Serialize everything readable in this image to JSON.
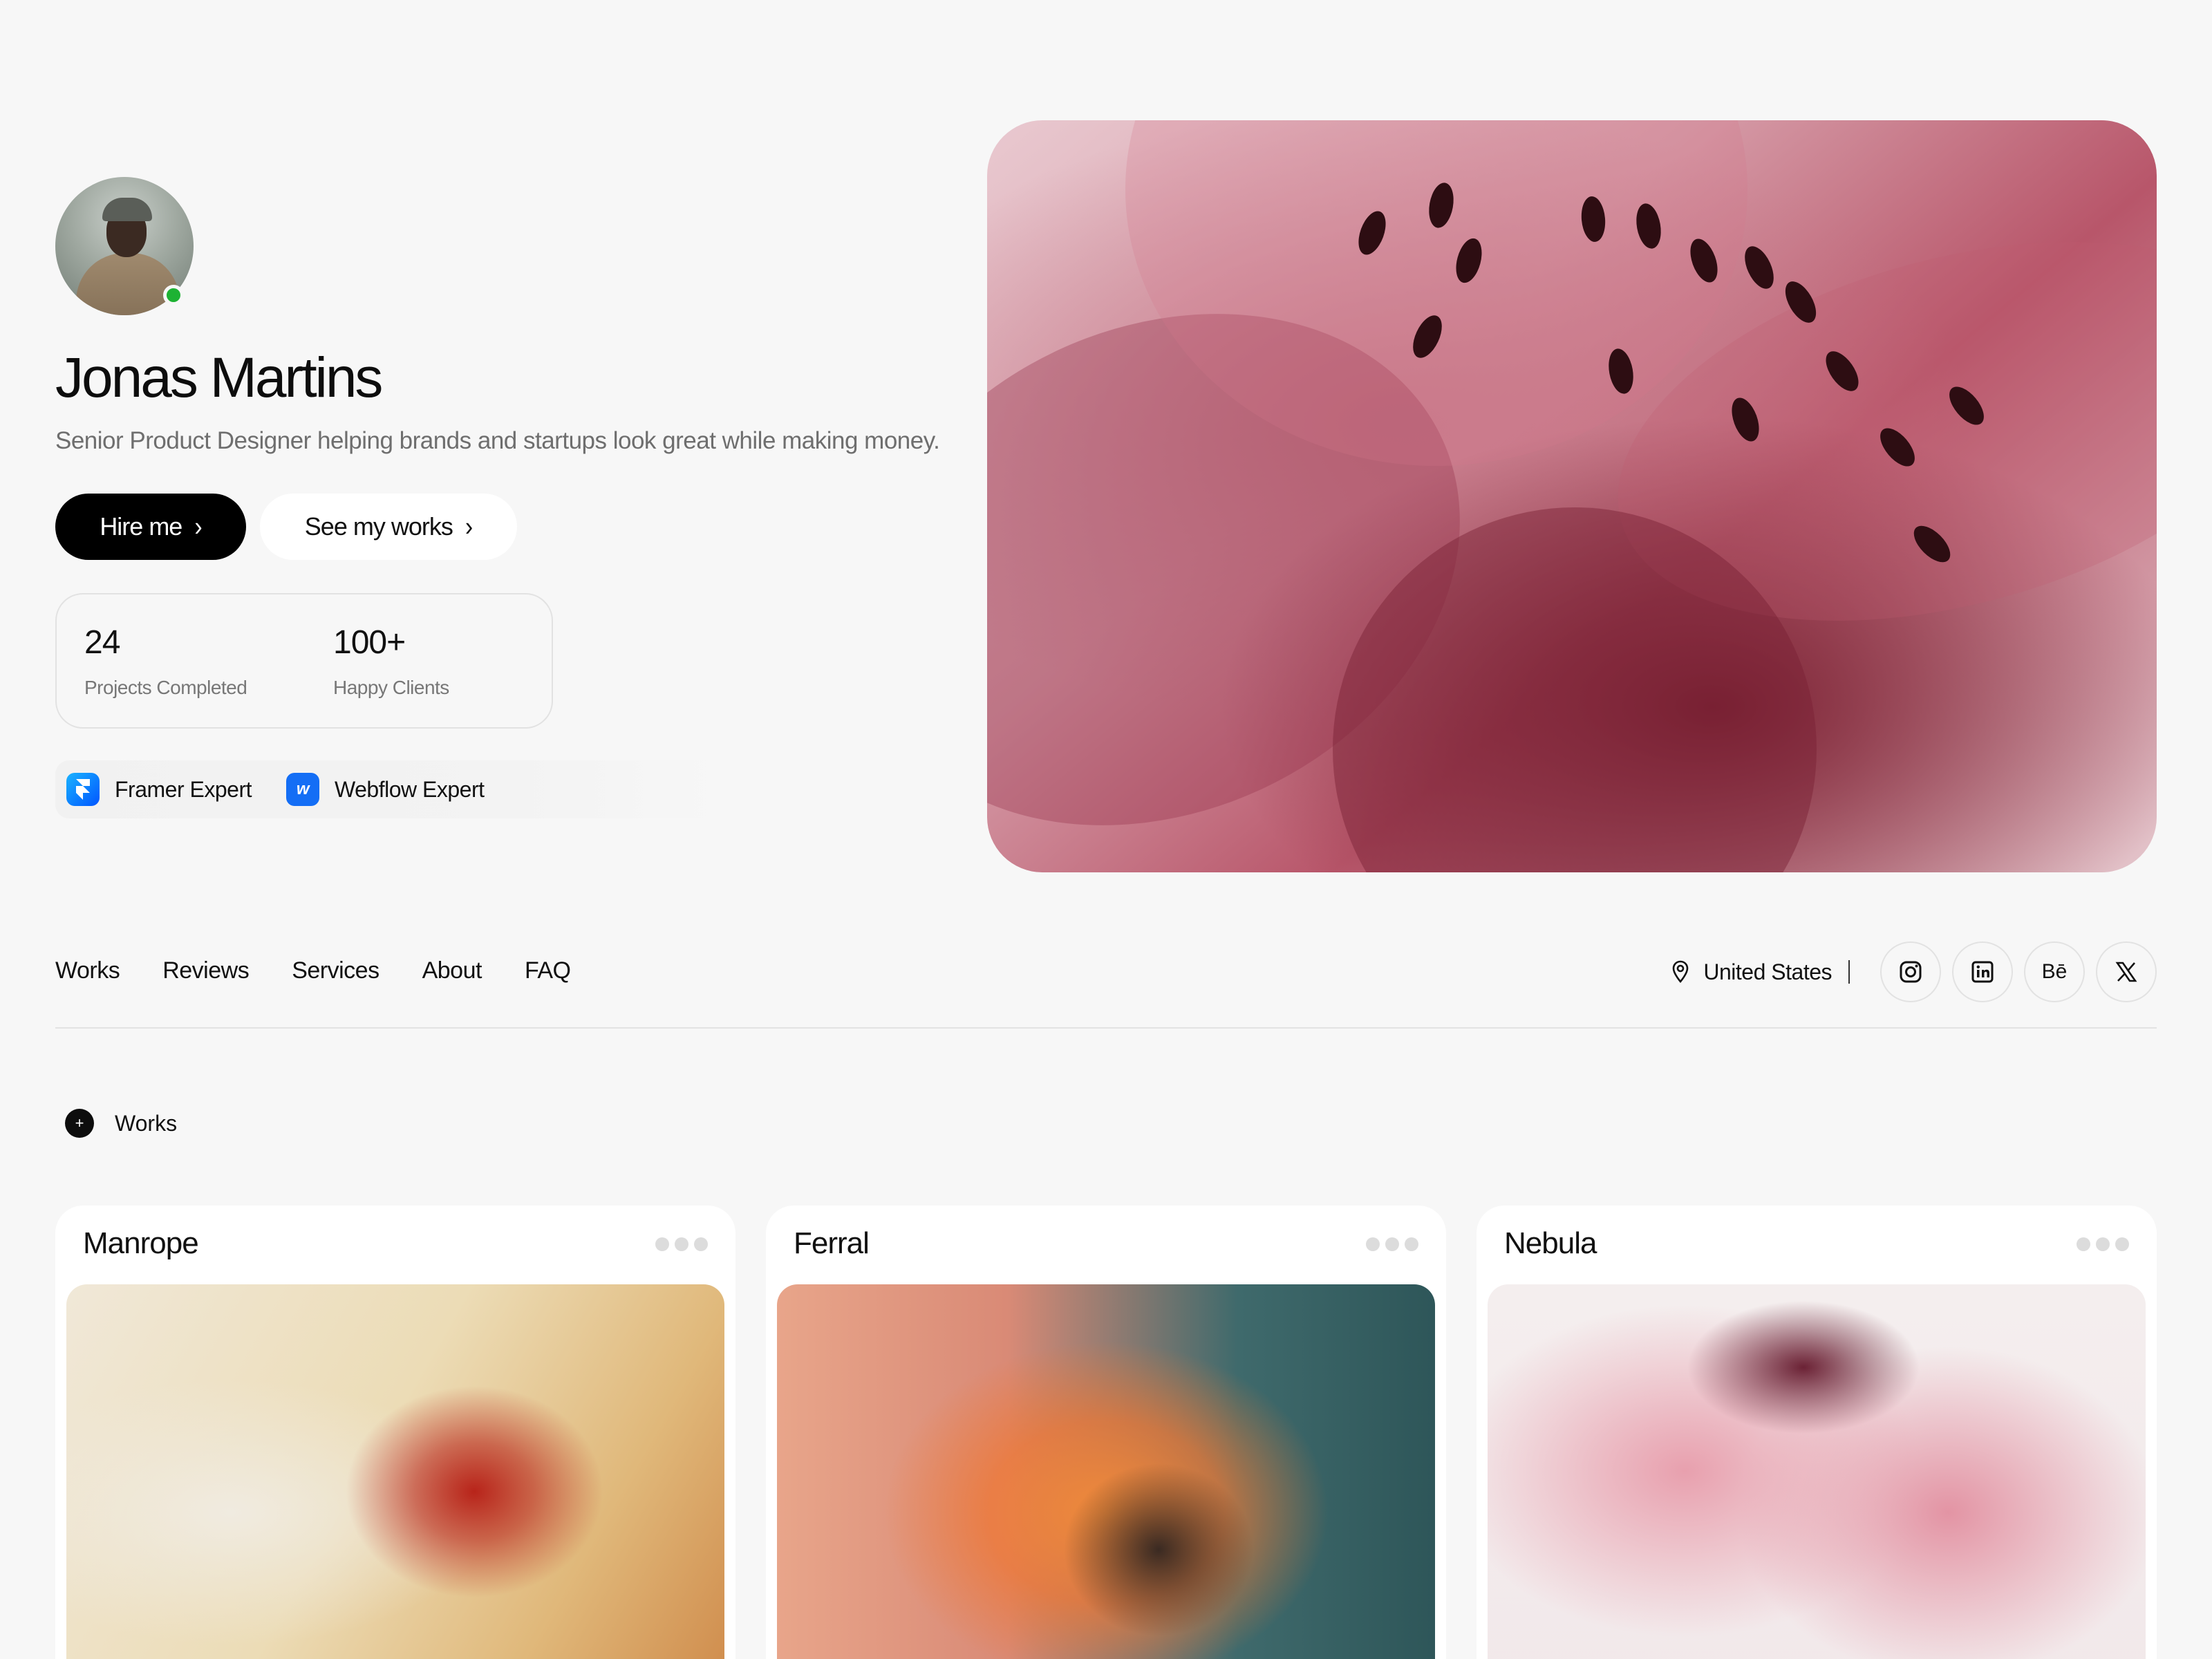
{
  "profile": {
    "name": "Jonas Martins",
    "bio": "Senior Product Designer helping brands and startups look great while making money."
  },
  "actions": {
    "hire_label": "Hire me",
    "works_label": "See my works"
  },
  "stats": [
    {
      "value": "24",
      "label": "Projects Completed"
    },
    {
      "value": "100+",
      "label": "Happy Clients"
    }
  ],
  "badges": [
    {
      "label": "Framer Expert",
      "icon": "framer-icon"
    },
    {
      "label": "Webflow Expert",
      "icon": "webflow-icon"
    }
  ],
  "nav": {
    "items": [
      "Works",
      "Reviews",
      "Services",
      "About",
      "FAQ"
    ],
    "location": "United States",
    "socials": [
      {
        "icon": "instagram-icon"
      },
      {
        "icon": "linkedin-icon"
      },
      {
        "icon": "behance-icon",
        "glyph": "Bē"
      },
      {
        "icon": "x-icon"
      }
    ]
  },
  "works_section": {
    "label": "Works",
    "cards": [
      {
        "title": "Manrope"
      },
      {
        "title": "Ferral"
      },
      {
        "title": "Nebula"
      }
    ]
  },
  "colors": {
    "background": "#f7f7f7",
    "primary_button": "#000000",
    "online_status": "#1db233"
  }
}
